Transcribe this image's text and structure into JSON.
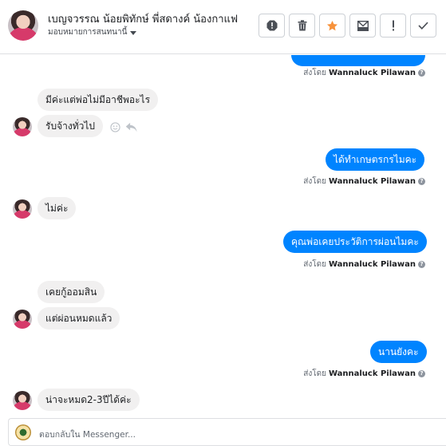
{
  "header": {
    "contact_name": "เบญจวรรณ น้อยพิทักษ์ พี่สดางค์ น้องกาแฟ",
    "assign_label": "มอบหมายการสนทนานี้",
    "toolbar": [
      "spam-alert-icon",
      "trash-icon",
      "star-icon",
      "mark-unread-icon",
      "exclamation-icon",
      "checkmark-icon"
    ]
  },
  "colors": {
    "accent": "#0084ff",
    "star": "#f7923b",
    "incoming_bg": "#f1f0f0"
  },
  "messages": {
    "m0": {
      "text": ""
    },
    "s0": {
      "prefix": "ส่งโดย",
      "sender": "Wannaluck Pilawan"
    },
    "m1": {
      "text": "มีค่ะแต่พ่อไม่มีอาชีพอะไร"
    },
    "m2": {
      "text": "รับจ้างทั่วไป"
    },
    "m3": {
      "text": "ได้ทำเกษตรกรไมคะ"
    },
    "s3": {
      "prefix": "ส่งโดย",
      "sender": "Wannaluck Pilawan"
    },
    "m4": {
      "text": "ไม่ค่ะ"
    },
    "m5": {
      "text": "คุณพ่อเคยประวัติการผ่อนไมคะ"
    },
    "s5": {
      "prefix": "ส่งโดย",
      "sender": "Wannaluck Pilawan"
    },
    "m6": {
      "text": "เคยกู้ออมสิน"
    },
    "m7": {
      "text": "แต่ผ่อนหมดแล้ว"
    },
    "m8": {
      "text": "นานยังคะ"
    },
    "s8": {
      "prefix": "ส่งโดย",
      "sender": "Wannaluck Pilawan"
    },
    "m9": {
      "text": "น่าจะหมด2-3ปีได้ค่ะ"
    }
  },
  "composer": {
    "placeholder": "ตอบกลับใน Messenger..."
  }
}
